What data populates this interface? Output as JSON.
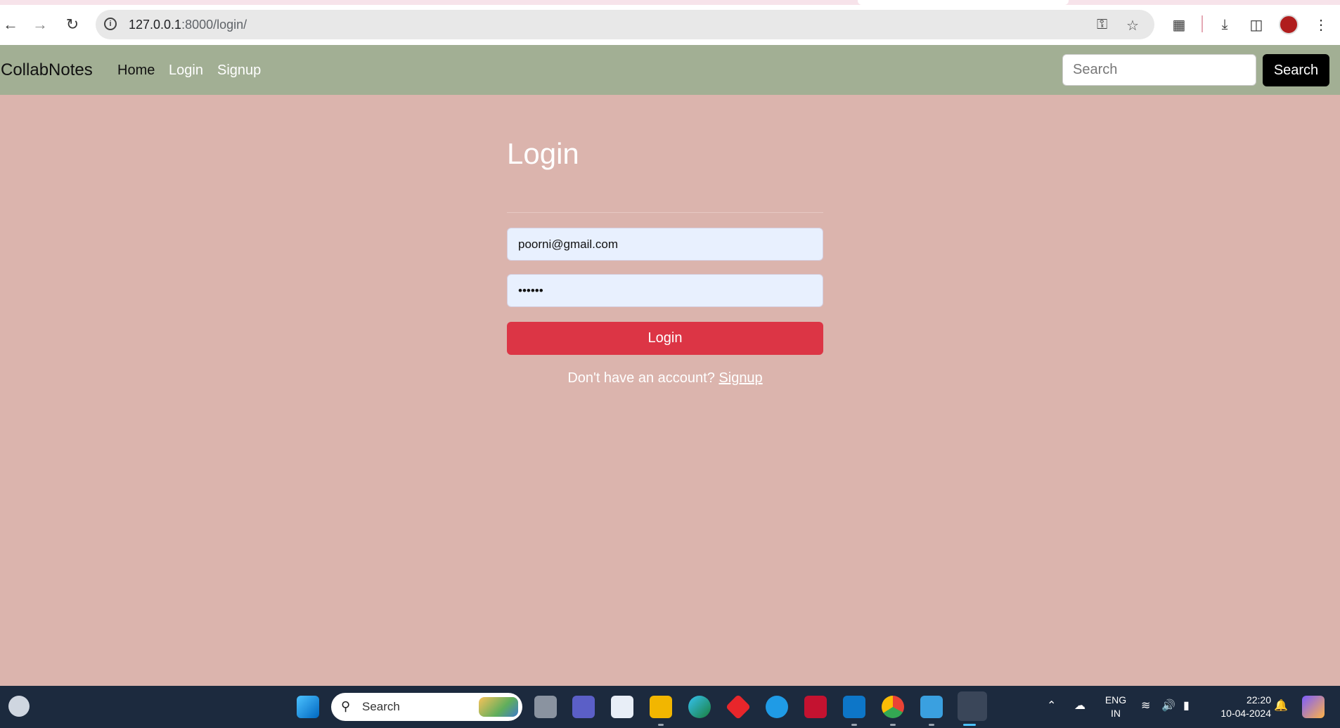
{
  "browser": {
    "url_host": "127.0.0.1",
    "url_path": ":8000/login/"
  },
  "navbar": {
    "brand": "CollabNotes",
    "links": [
      {
        "label": "Home",
        "color": "#111111"
      },
      {
        "label": "Login",
        "color": "#ffffff"
      },
      {
        "label": "Signup",
        "color": "#ffffff"
      }
    ],
    "search_placeholder": "Search",
    "search_button": "Search"
  },
  "login": {
    "title": "Login",
    "email_value": "poorni@gmail.com",
    "password_value": "••••••",
    "button": "Login",
    "prompt": "Don't have an account?",
    "signup_link": "Signup"
  },
  "taskbar": {
    "search_label": "Search",
    "lang_line1": "ENG",
    "lang_line2": "IN",
    "time": "22:20",
    "date": "10-04-2024"
  },
  "colors": {
    "page_bg": "#dbb4ad",
    "navbar_bg": "#a2af94",
    "login_button": "#dc3545",
    "input_bg": "#e8f0fe",
    "taskbar_bg": "#1c2a3e"
  }
}
